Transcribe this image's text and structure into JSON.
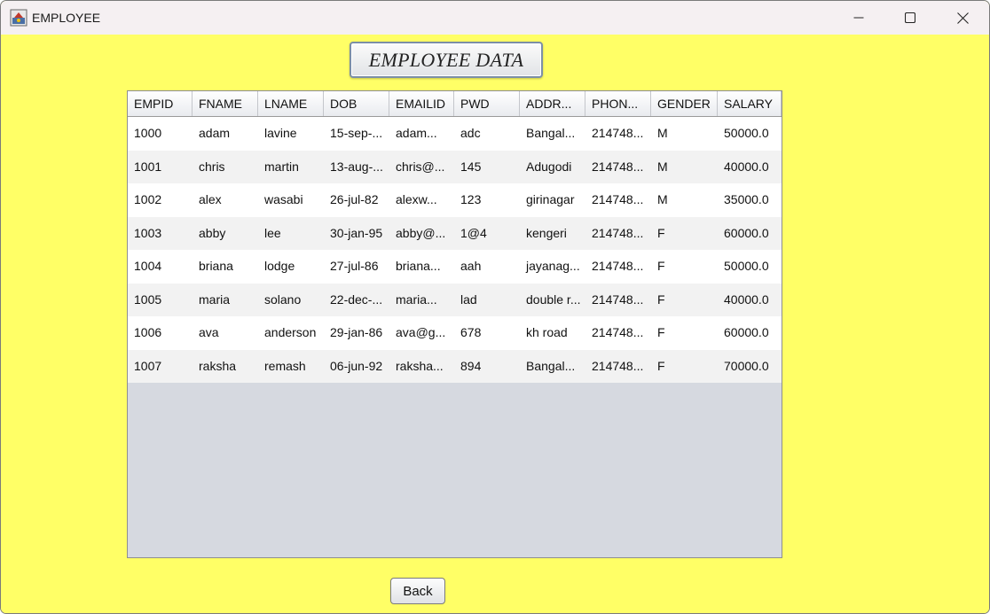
{
  "window": {
    "title": "EMPLOYEE"
  },
  "heading": "EMPLOYEE DATA",
  "table": {
    "columns": [
      "EMPID",
      "FNAME",
      "LNAME",
      "DOB",
      "EMAILID",
      "PWD",
      "ADDR...",
      "PHON...",
      "GENDER",
      "SALARY"
    ],
    "rows": [
      [
        "1000",
        "adam",
        "lavine",
        "15-sep-...",
        "adam...",
        "adc",
        "Bangal...",
        "214748...",
        "M",
        "50000.0"
      ],
      [
        "1001",
        "chris",
        "martin",
        "13-aug-...",
        "chris@...",
        "145",
        "Adugodi",
        "214748...",
        "M",
        "40000.0"
      ],
      [
        "1002",
        "alex",
        "wasabi",
        "26-jul-82",
        "alexw...",
        "123",
        "girinagar",
        "214748...",
        "M",
        "35000.0"
      ],
      [
        "1003",
        "abby",
        "lee",
        "30-jan-95",
        "abby@...",
        "1@4",
        "kengeri",
        "214748...",
        "F",
        "60000.0"
      ],
      [
        "1004",
        "briana",
        "lodge",
        "27-jul-86",
        "briana...",
        "aah",
        "jayanag...",
        "214748...",
        "F",
        "50000.0"
      ],
      [
        "1005",
        "maria",
        "solano",
        "22-dec-...",
        "maria...",
        "lad",
        "double r...",
        "214748...",
        "F",
        "40000.0"
      ],
      [
        "1006",
        "ava",
        "anderson",
        "29-jan-86",
        "ava@g...",
        "678",
        "kh road",
        "214748...",
        "F",
        "60000.0"
      ],
      [
        "1007",
        "raksha",
        "remash",
        "06-jun-92",
        "raksha...",
        "894",
        "Bangal...",
        "214748...",
        "F",
        "70000.0"
      ]
    ]
  },
  "back_button": "Back",
  "colors": {
    "background": "#ffff66",
    "titlebar": "#f5f0f2",
    "empty_table_area": "#d6d9e0"
  },
  "icons": {
    "app": "java-app-icon",
    "minimize": "minimize-icon",
    "maximize": "maximize-icon",
    "close": "close-icon"
  }
}
